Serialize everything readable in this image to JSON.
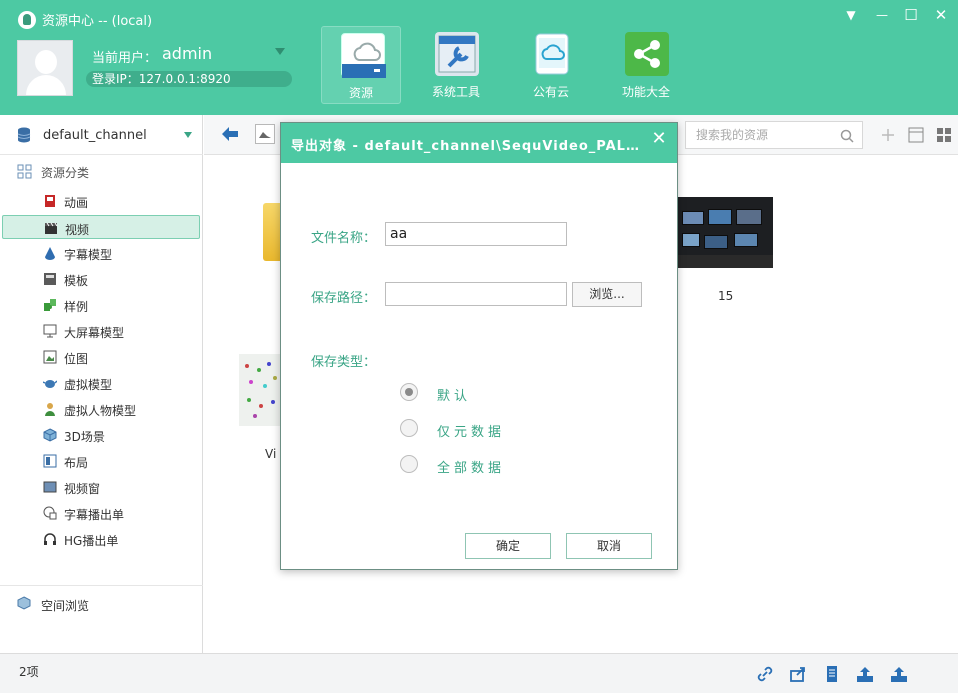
{
  "app": {
    "title": "资源中心 -- (local)"
  },
  "window_controls": {
    "menu": "▼",
    "minimize": "—",
    "maximize": "☐",
    "close": "✕"
  },
  "user": {
    "label": "当前用户：",
    "name": "admin",
    "ip": "登录IP：127.0.0.1:8920"
  },
  "nav": [
    {
      "label": "资源",
      "icon": "cloud-disk-icon",
      "active": true
    },
    {
      "label": "系统工具",
      "icon": "tools-icon",
      "active": false
    },
    {
      "label": "公有云",
      "icon": "cloud-phone-icon",
      "active": false
    },
    {
      "label": "功能大全",
      "icon": "share-icon",
      "active": false
    }
  ],
  "sidebar": {
    "channel": "default_channel",
    "category_header": "资源分类",
    "items": [
      {
        "label": "动画",
        "icon": "animation-icon"
      },
      {
        "label": "视频",
        "icon": "clapperboard-icon",
        "selected": true
      },
      {
        "label": "字幕模型",
        "icon": "drop-icon"
      },
      {
        "label": "模板",
        "icon": "template-icon"
      },
      {
        "label": "样例",
        "icon": "puzzle-icon"
      },
      {
        "label": "大屏幕模型",
        "icon": "monitor-icon"
      },
      {
        "label": "位图",
        "icon": "bitmap-icon"
      },
      {
        "label": "虚拟模型",
        "icon": "teapot-icon"
      },
      {
        "label": "虚拟人物模型",
        "icon": "person-icon"
      },
      {
        "label": "3D场景",
        "icon": "cube-icon"
      },
      {
        "label": "布局",
        "icon": "layout-icon"
      },
      {
        "label": "视频窗",
        "icon": "video-window-icon"
      },
      {
        "label": "字幕播出单",
        "icon": "subtitle-playlist-icon"
      },
      {
        "label": "HG播出单",
        "icon": "headphones-icon"
      }
    ],
    "space_browse": "空间浏览"
  },
  "toolbar": {
    "search_placeholder": "搜索我的资源"
  },
  "content": {
    "items": [
      {
        "label": "",
        "kind": "folder"
      },
      {
        "label": "15",
        "kind": "video"
      },
      {
        "label": "Vi",
        "kind": "video"
      }
    ]
  },
  "status": {
    "count": "2项"
  },
  "dialog": {
    "title": "导出对象 - default_channel\\SequVideo_PAL...",
    "close": "✕",
    "filename_label": "文件名称：",
    "filename_value": "aa",
    "path_label": "保存路径：",
    "path_value": "",
    "browse": "浏览...",
    "type_label": "保存类型：",
    "options": [
      "默认",
      "仅元数据",
      "全部数据"
    ],
    "selected_option": "默认",
    "ok": "确定",
    "cancel": "取消"
  },
  "colors": {
    "accent": "#4dc9a3",
    "accent_dark": "#3aa586"
  }
}
